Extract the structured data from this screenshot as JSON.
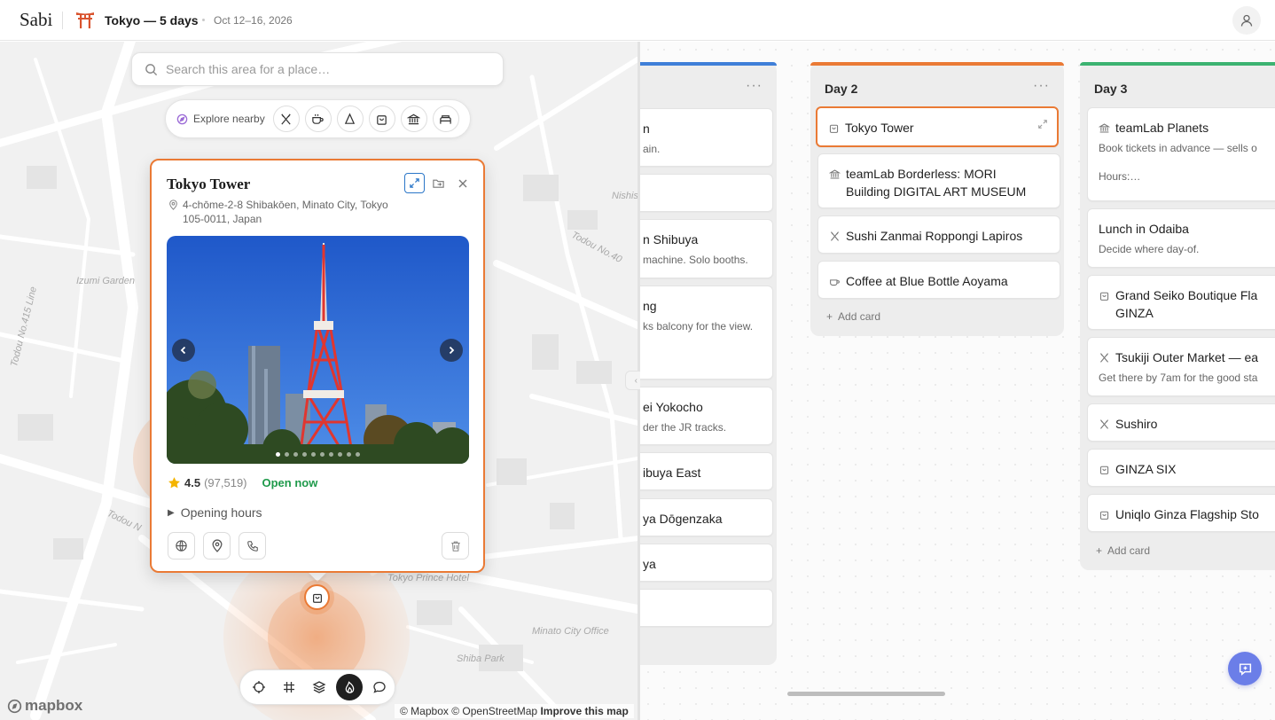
{
  "app": {
    "brand": "Sabi",
    "trip_title": "Tokyo — 5 days",
    "trip_dates": "Oct 12–16, 2026"
  },
  "map": {
    "search_placeholder": "Search this area for a place…",
    "explore_label": "Explore nearby",
    "categories": [
      "restaurants-icon",
      "cafe-icon",
      "attractions-icon",
      "shopping-icon",
      "museum-icon",
      "hotel-icon"
    ],
    "labels": {
      "nishi": "Nishis",
      "izumi": "Izumi Garden",
      "todou415": "Todou No.415 Line",
      "todou40": "Todou No.40",
      "todou_n": "Todou N",
      "tokyo_prince": "Tokyo Prince Hotel",
      "minato": "Minato City Office",
      "shiba_park": "Shiba Park"
    },
    "controls": [
      "locate-icon",
      "grid-icon",
      "layers-icon",
      "heatmap-icon",
      "comment-icon"
    ],
    "attribution": {
      "mapbox": "© Mapbox",
      "osm": "© OpenStreetMap",
      "improve": "Improve this map"
    },
    "mapbox_logo": "mapbox"
  },
  "popup": {
    "title": "Tokyo Tower",
    "address": "4-chōme-2-8 Shibakōen, Minato City, Tokyo 105-0011, Japan",
    "rating": "4.5",
    "rating_count": "(97,519)",
    "open_status": "Open now",
    "opening_hours_label": "Opening hours",
    "photo_count": 10,
    "photo_index": 1
  },
  "board": {
    "columns": [
      {
        "title": "",
        "color": "#3f7fd8",
        "cards": [
          {
            "title": "n",
            "note": "ain."
          },
          {
            "title": "",
            "note": ""
          },
          {
            "title": "n Shibuya",
            "note": "machine. Solo booths."
          },
          {
            "title": "ng",
            "note": "ks balcony for the view."
          },
          {
            "title": "ei Yokocho",
            "note": "der the JR tracks."
          },
          {
            "title": "ibuya East",
            "note": ""
          },
          {
            "title": "ya Dōgenzaka",
            "note": ""
          },
          {
            "title": "ya",
            "note": ""
          },
          {
            "title": "",
            "note": ""
          }
        ]
      },
      {
        "title": "Day 2",
        "color": "#ea7a35",
        "add_label": "Add card",
        "cards": [
          {
            "title": "Tokyo Tower",
            "icon": "shopping-icon",
            "note": ""
          },
          {
            "title": "teamLab Borderless: MORI Building DIGITAL ART MUSEUM",
            "icon": "museum-icon",
            "note": ""
          },
          {
            "title": "Sushi Zanmai Roppongi Lapiros",
            "icon": "restaurants-icon",
            "note": ""
          },
          {
            "title": "Coffee at Blue Bottle Aoyama",
            "icon": "cafe-icon",
            "note": ""
          }
        ]
      },
      {
        "title": "Day 3",
        "color": "#3cb371",
        "add_label": "Add card",
        "cards": [
          {
            "title": "teamLab Planets",
            "icon": "museum-icon",
            "note": "Book tickets in advance — sells o\n\nHours:…"
          },
          {
            "title": "Lunch in Odaiba",
            "icon": "",
            "note": "Decide where day-of."
          },
          {
            "title": "Grand Seiko Boutique Fla GINZA",
            "icon": "shopping-icon",
            "note": ""
          },
          {
            "title": "Tsukiji Outer Market — ea",
            "icon": "restaurants-icon",
            "note": "Get there by 7am for the good sta"
          },
          {
            "title": "Sushiro",
            "icon": "restaurants-icon",
            "note": ""
          },
          {
            "title": "GINZA SIX",
            "icon": "shopping-icon",
            "note": ""
          },
          {
            "title": "Uniqlo Ginza Flagship Sto",
            "icon": "shopping-icon",
            "note": ""
          }
        ]
      }
    ]
  },
  "colors": {
    "accent": "#ea7a35",
    "open": "#1f9a4b",
    "chat": "#6b7ee8",
    "active_tool": "#2a76c8"
  }
}
